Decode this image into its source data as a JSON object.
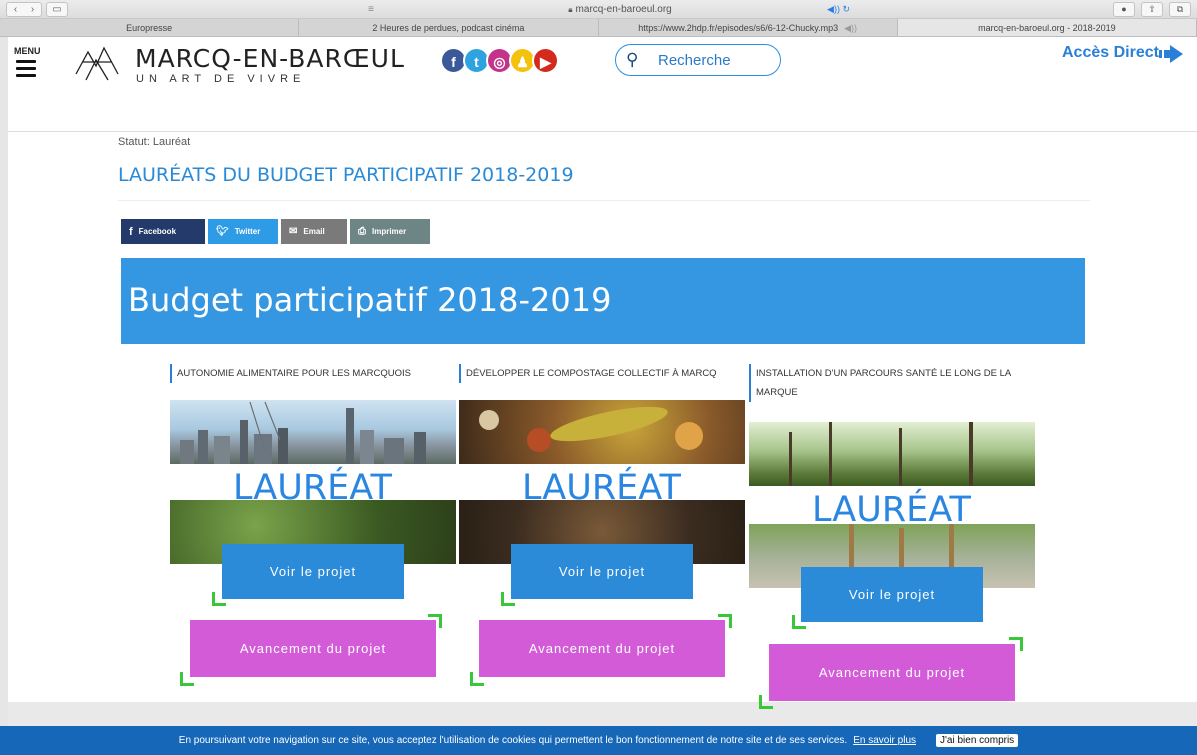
{
  "browser": {
    "url": "marcq-en-baroeul.org",
    "tabs": [
      {
        "label": "Europresse"
      },
      {
        "label": "2 Heures de perdues, podcast cinéma"
      },
      {
        "label": "https://www.2hdp.fr/episodes/s6/6-12-Chucky.mp3"
      },
      {
        "label": "marcq-en-baroeul.org - 2018-2019"
      }
    ]
  },
  "header": {
    "menu_label": "MENU",
    "logo_title": "MARCQ-EN-BARŒUL",
    "logo_subtitle": "UN ART DE VIVRE",
    "search_placeholder": "Recherche",
    "acces_direct": "Accès Direct"
  },
  "socials": [
    {
      "name": "facebook",
      "glyph": "f",
      "color": "#3b5998"
    },
    {
      "name": "twitter",
      "glyph": "t",
      "color": "#2fa3e0"
    },
    {
      "name": "instagram",
      "glyph": "◎",
      "color": "#c4338a"
    },
    {
      "name": "snapchat",
      "glyph": "♟",
      "color": "#f4c20d"
    },
    {
      "name": "youtube",
      "glyph": "▶",
      "color": "#d42a1e"
    }
  ],
  "page": {
    "statut": "Statut: Lauréat",
    "title": "LAURÉATS DU BUDGET PARTICIPATIF 2018-2019",
    "banner": "Budget participatif 2018-2019"
  },
  "share": {
    "facebook": "Facebook",
    "twitter": "Twitter",
    "email": "Email",
    "imprimer": "Imprimer"
  },
  "projects": [
    {
      "title": "AUTONOMIE ALIMENTAIRE POUR LES MARCQUOIS",
      "badge": "LAURÉAT",
      "voir": "Voir le projet",
      "avancement": "Avancement du projet"
    },
    {
      "title": "DÉVELOPPER LE COMPOSTAGE COLLECTIF À MARCQ",
      "badge": "LAURÉAT",
      "voir": "Voir le projet",
      "avancement": "Avancement du projet"
    },
    {
      "title": "INSTALLATION D'UN PARCOURS SANTÉ LE LONG DE LA MARQUE",
      "badge": "LAURÉAT",
      "voir": "Voir le projet",
      "avancement": "Avancement du projet"
    }
  ],
  "cookie": {
    "text": "En poursuivant votre navigation sur ce site, vous acceptez l'utilisation de cookies qui permettent le bon fonctionnement de notre site et de ses services.",
    "link": "En savoir plus",
    "button": "J'ai bien compris"
  }
}
